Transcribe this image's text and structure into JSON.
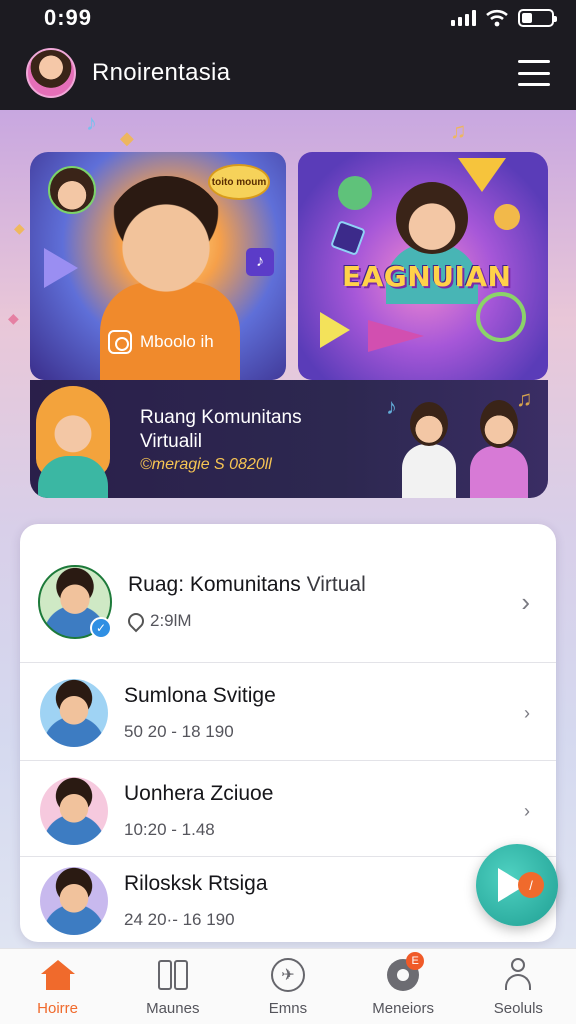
{
  "status_bar": {
    "time": "0:99"
  },
  "app_bar": {
    "title": "Rnoirentasia"
  },
  "banner": {
    "bubble_text": "toito moum",
    "instagram_handle": "Mboolo ih",
    "game_title": "EAGNUIAN",
    "promo_title_line1": "Ruang Komunitans",
    "promo_title_line2": "Virtualil",
    "promo_date": "©meragie S 0820ll"
  },
  "list": {
    "featured": {
      "title_bold": "Ruag: Komunitans",
      "title_light": " Virtual",
      "meta": "2:9lM"
    },
    "items": [
      {
        "title": "Sumlona Svitige",
        "meta": "50 20 - 18 190"
      },
      {
        "title": "Uonhera Zciuoe",
        "meta": "10:20 - 1.48"
      },
      {
        "title": "Rilosksk Rtsiga",
        "meta": "24 20·- 16 190"
      }
    ]
  },
  "fab": {
    "badge": "/"
  },
  "tabs": [
    {
      "label": "Hoirre",
      "icon": "home-icon",
      "active": true
    },
    {
      "label": "Maunes",
      "icon": "devices-icon"
    },
    {
      "label": "Emns",
      "icon": "bird-icon"
    },
    {
      "label": "Meneiors",
      "icon": "gear-icon",
      "badge": "E"
    },
    {
      "label": "Seoluls",
      "icon": "person-icon"
    }
  ],
  "colors": {
    "accent": "#f06a2c",
    "app_bar": "#1c1b21",
    "fab": "#1f9f93"
  }
}
